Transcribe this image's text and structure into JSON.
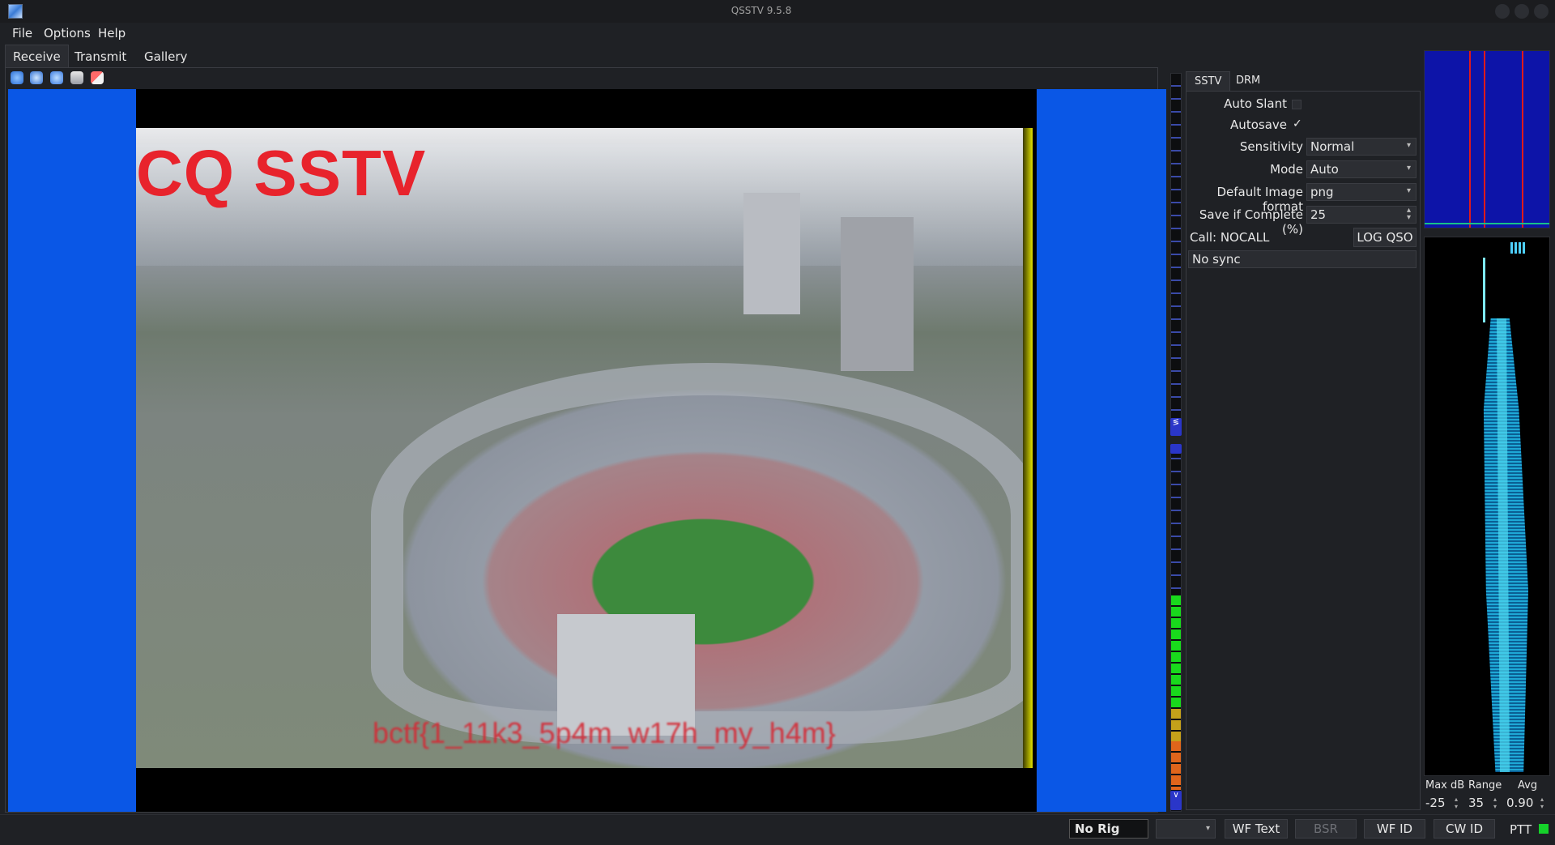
{
  "window": {
    "title": "QSSTV 9.5.8"
  },
  "menu": {
    "items": [
      "File",
      "Options",
      "Help"
    ]
  },
  "tabs": [
    "Receive",
    "Transmit",
    "Gallery"
  ],
  "image": {
    "overlay_top": "CQ SSTV",
    "overlay_bottom": "bctf{1_11k3_5p4m_w17h_my_h4m}"
  },
  "panel": {
    "tabs": [
      "SSTV",
      "DRM"
    ],
    "auto_slant_label": "Auto Slant",
    "auto_slant_checked": false,
    "autosave_label": "Autosave",
    "autosave_mark": "✓",
    "sensitivity_label": "Sensitivity",
    "sensitivity_value": "Normal",
    "mode_label": "Mode",
    "mode_value": "Auto",
    "format_label": "Default Image format",
    "format_value": "png",
    "save_complete_label": "Save if Complete (%)",
    "save_complete_value": "25",
    "call_label": "Call: NOCALL",
    "log_qso_label": "LOG QSO",
    "sync_status": "No sync"
  },
  "waterfall": {
    "maxdb_label": "Max dB",
    "maxdb_value": "-25",
    "range_label": "Range",
    "range_value": "35",
    "avg_label": "Avg",
    "avg_value": "0.90"
  },
  "status": {
    "rig": "No Rig",
    "rig_select": "",
    "wf_text": "WF Text",
    "bsr": "BSR",
    "wf_id": "WF ID",
    "cw_id": "CW ID",
    "ptt": "PTT"
  },
  "colors": {
    "accent_blue": "#0a57e6",
    "ptt_led": "#15d22a"
  }
}
